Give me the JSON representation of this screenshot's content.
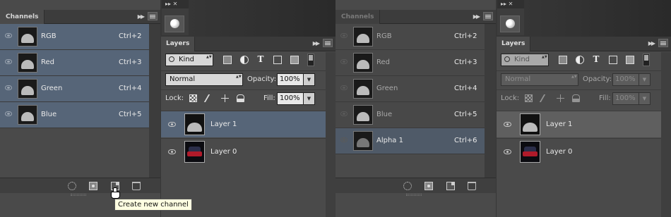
{
  "left": {
    "channels_panel": {
      "tab_label": "Channels",
      "channels": [
        {
          "name": "RGB",
          "shortcut": "Ctrl+2"
        },
        {
          "name": "Red",
          "shortcut": "Ctrl+3"
        },
        {
          "name": "Green",
          "shortcut": "Ctrl+4"
        },
        {
          "name": "Blue",
          "shortcut": "Ctrl+5"
        }
      ],
      "tooltip": "Create new channel"
    },
    "layers_panel": {
      "tab_label": "Layers",
      "filter_kind": "Kind",
      "blend_mode": "Normal",
      "opacity_label": "Opacity:",
      "opacity_value": "100%",
      "lock_label": "Lock:",
      "fill_label": "Fill:",
      "fill_value": "100%",
      "layers": [
        {
          "name": "Layer 1"
        },
        {
          "name": "Layer 0"
        }
      ]
    }
  },
  "right": {
    "channels_panel": {
      "tab_label": "Channels",
      "channels": [
        {
          "name": "RGB",
          "shortcut": "Ctrl+2"
        },
        {
          "name": "Red",
          "shortcut": "Ctrl+3"
        },
        {
          "name": "Green",
          "shortcut": "Ctrl+4"
        },
        {
          "name": "Blue",
          "shortcut": "Ctrl+5"
        },
        {
          "name": "Alpha 1",
          "shortcut": "Ctrl+6"
        }
      ]
    },
    "layers_panel": {
      "tab_label": "Layers",
      "filter_kind": "Kind",
      "blend_mode": "Normal",
      "opacity_label": "Opacity:",
      "opacity_value": "100%",
      "lock_label": "Lock:",
      "fill_label": "Fill:",
      "fill_value": "100%",
      "layers": [
        {
          "name": "Layer 1"
        },
        {
          "name": "Layer 0"
        }
      ]
    }
  },
  "colors": {
    "selection_blue": "#566578",
    "panel_bg": "#4a4a4a",
    "tooltip_bg": "#ffffe1"
  }
}
